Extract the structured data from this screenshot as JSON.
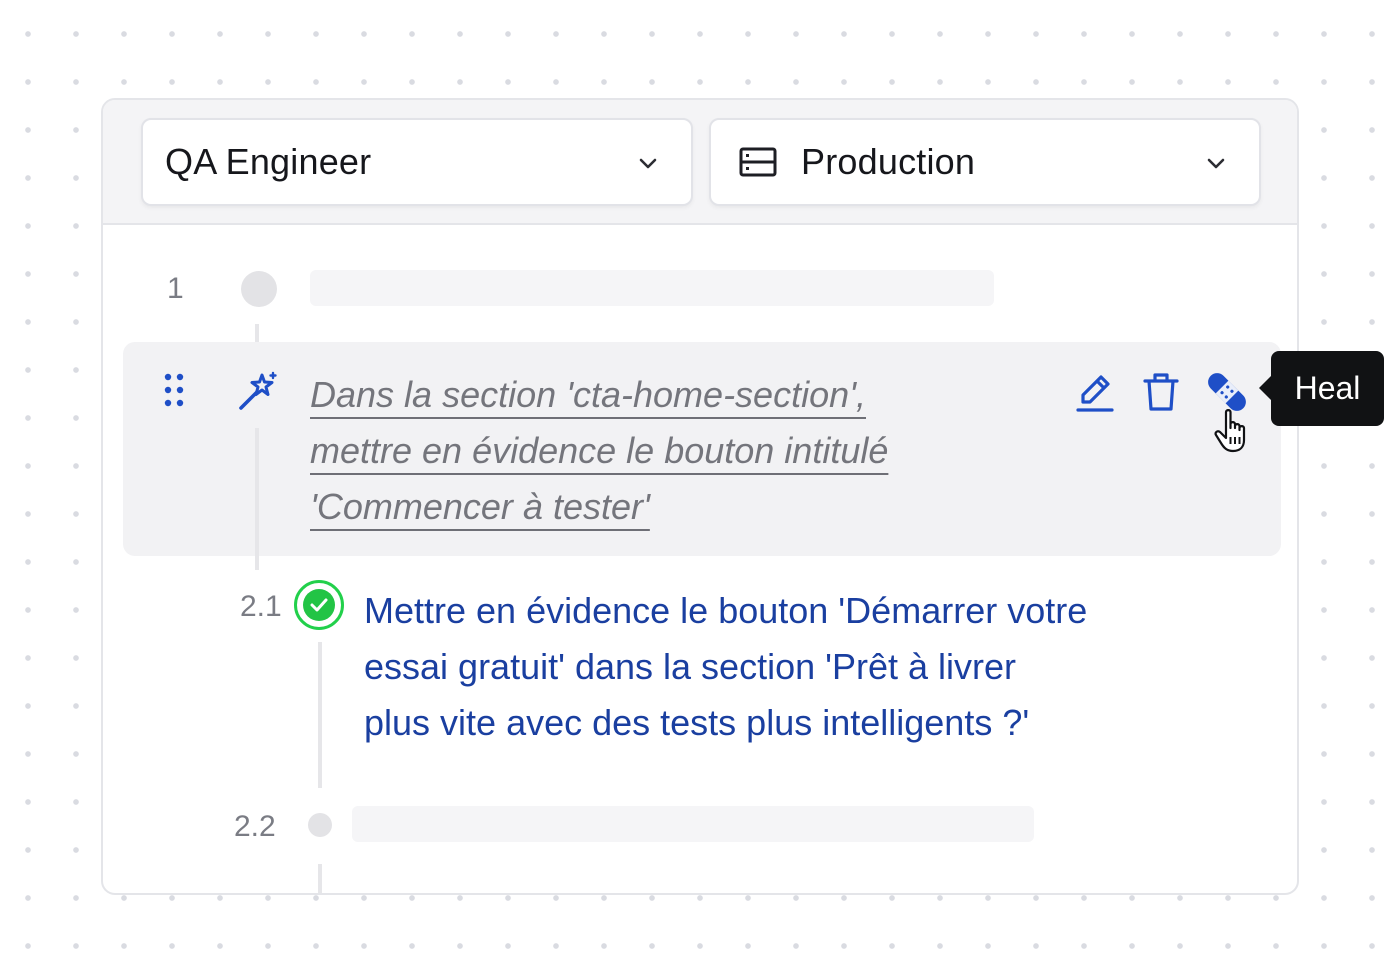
{
  "toolbar": {
    "role_select": {
      "value": "QA Engineer"
    },
    "environment_select": {
      "value": "Production"
    }
  },
  "steps": {
    "step1": {
      "number": "1"
    },
    "step2": {
      "instruction_lines": [
        "Dans la section 'cta-home-section',",
        "mettre en évidence le bouton intitulé",
        "'Commencer à tester'"
      ]
    },
    "step2_1": {
      "number": "2.1",
      "lines": [
        "Mettre en évidence le bouton 'Démarrer votre",
        "essai gratuit' dans la section 'Prêt à livrer",
        "plus vite avec des tests plus intelligents ?'"
      ]
    },
    "step2_2": {
      "number": "2.2"
    }
  },
  "tooltip": {
    "label": "Heal"
  },
  "colors": {
    "accent_blue": "#1a3fa0",
    "success_green": "#22c445",
    "tooltip_bg": "#111214"
  },
  "icons": {
    "role_chevron": "chevron-down-icon",
    "environment": "server-icon",
    "drag": "drag-handle-icon",
    "ai": "magic-wand-icon",
    "edit": "pencil-icon",
    "delete": "trash-icon",
    "heal": "bandage-icon",
    "status": "check-circle-icon",
    "cursor": "hand-pointer-icon"
  }
}
